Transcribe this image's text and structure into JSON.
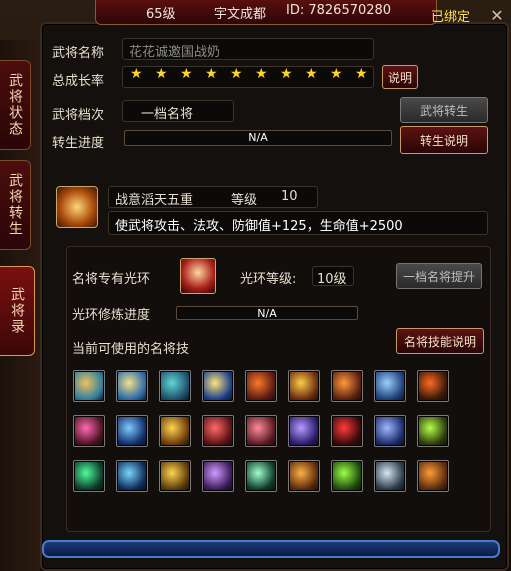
{
  "topbar": {
    "level": "65级",
    "name": "宇文成都",
    "id_text": "ID: 7826570280",
    "bound_text": "已绑定"
  },
  "tabs": [
    {
      "label": "武将状态"
    },
    {
      "label": "武将转生"
    },
    {
      "label": "武将录"
    }
  ],
  "general": {
    "name_label": "武将名称",
    "name_value": "花花诚邀国战奶",
    "growth_label": "总成长率",
    "stars": "★ ★ ★ ★ ★ ★ ★ ★ ★ ★",
    "explain_button": "说明",
    "tier_label": "武将档次",
    "tier_value": "一档名将",
    "rebirth_button": "武将转生",
    "rebirth_progress_label": "转生进度",
    "rebirth_progress_value": "N/A",
    "rebirth_explain_button": "转生说明"
  },
  "buff": {
    "title": "战意滔天五重",
    "level_label": "等级",
    "level_value": "10",
    "desc": "使武将攻击、法攻、防御值+125，生命值+2500"
  },
  "aura": {
    "label": "名将专有光环",
    "level_label": "光环等级:",
    "level_value": "10级",
    "promote_button": "一档名将提升",
    "progress_label": "光环修炼进度",
    "progress_value": "N/A",
    "skills_label": "当前可使用的名将技",
    "skills_explain_button": "名将技能说明"
  },
  "colors": {
    "gold": "#ffd32b",
    "frame": "#3b2a1d",
    "red_btn": "#5c1212",
    "blue_bar": "#4b79cf"
  },
  "skill_icons": [
    {
      "name": "axe-skill-icon",
      "c1": "#2f7ea0",
      "c2": "#f0c35a"
    },
    {
      "name": "hammer-skill-icon",
      "c1": "#2a6aa8",
      "c2": "#f3e08b"
    },
    {
      "name": "swirl-skill-icon",
      "c1": "#1d4f6a",
      "c2": "#62d6d6"
    },
    {
      "name": "lightning-skill-icon",
      "c1": "#1b3f8b",
      "c2": "#ffe37a"
    },
    {
      "name": "slash-skill-icon",
      "c1": "#5a1a12",
      "c2": "#ff7a2a"
    },
    {
      "name": "fire-weapon-skill-icon",
      "c1": "#6a2b10",
      "c2": "#ffcc4a"
    },
    {
      "name": "flame-sword-skill-icon",
      "c1": "#5a2010",
      "c2": "#ff9b3a"
    },
    {
      "name": "dash-skill-icon",
      "c1": "#1f3f7a",
      "c2": "#9ad1ff"
    },
    {
      "name": "fire-warrior-skill-icon",
      "c1": "#3a1808",
      "c2": "#ff6a22"
    },
    {
      "name": "pink-wings-skill-icon",
      "c1": "#4a1220",
      "c2": "#ff69b4"
    },
    {
      "name": "blue-dragon-skill-icon",
      "c1": "#0f2d6a",
      "c2": "#7fc9ff"
    },
    {
      "name": "golden-wings-skill-icon",
      "c1": "#6a3a0a",
      "c2": "#ffd44f"
    },
    {
      "name": "red-dragon-skill-icon",
      "c1": "#5a1212",
      "c2": "#ff6a6a"
    },
    {
      "name": "heart-skill-icon",
      "c1": "#5a1a22",
      "c2": "#ff8a9a"
    },
    {
      "name": "vortex-skill-icon",
      "c1": "#2a1a6a",
      "c2": "#b59bff"
    },
    {
      "name": "demon-skill-icon",
      "c1": "#3a0a0a",
      "c2": "#ff3a3a"
    },
    {
      "name": "blue-circle-skill-icon",
      "c1": "#1b2a6a",
      "c2": "#a0b8ff"
    },
    {
      "name": "goblin-skill-icon",
      "c1": "#2a3a0a",
      "c2": "#b4ff4a"
    },
    {
      "name": "green-figure-skill-icon",
      "c1": "#0d3a2a",
      "c2": "#4dff9b"
    },
    {
      "name": "blue-spirit-skill-icon",
      "c1": "#0d2a5a",
      "c2": "#7ad7ff"
    },
    {
      "name": "golden-soldier-skill-icon",
      "c1": "#5a3a0a",
      "c2": "#ffd44f"
    },
    {
      "name": "purple-heart-skill-icon",
      "c1": "#3a1a5a",
      "c2": "#d29bff"
    },
    {
      "name": "green-spirit-skill-icon",
      "c1": "#0d3a2a",
      "c2": "#a0ffcf"
    },
    {
      "name": "orange-army-skill-icon",
      "c1": "#5a2a0a",
      "c2": "#ffb04a"
    },
    {
      "name": "green-warrior-skill-icon",
      "c1": "#1d4a0a",
      "c2": "#9dff4a"
    },
    {
      "name": "silver-skill-icon",
      "c1": "#2a3a4a",
      "c2": "#d9e6f2"
    },
    {
      "name": "fire-ranger-skill-icon",
      "c1": "#5a2a0a",
      "c2": "#ff9b3a"
    }
  ]
}
